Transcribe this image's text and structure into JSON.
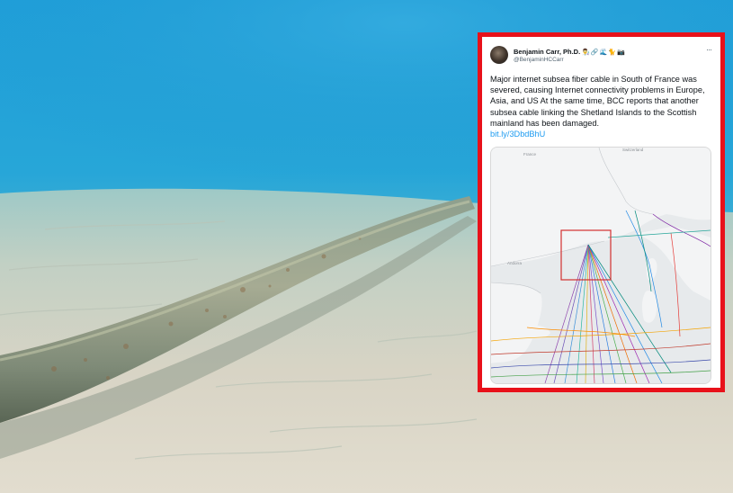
{
  "tweet": {
    "author_name": "Benjamin Carr, Ph.D.",
    "author_emojis": "👨‍🔬🔗🌊🐈📷",
    "handle": "@BenjaminHCCarr",
    "more_menu": "···",
    "body": "Major internet subsea fiber cable in South of France was severed, causing Internet connectivity problems in Europe, Asia, and US At the same time, BCC reports that another subsea cable linking the Shetland Islands to the Scottish mainland has been damaged.",
    "link": "bit.ly/3DbdBhU"
  },
  "map": {
    "labels": [
      "France",
      "Switzerland",
      "Andorra"
    ]
  },
  "colors": {
    "frame_border": "#e8111a",
    "link": "#1d9bf0",
    "water": "#2aa3d8",
    "sand": "#d6d2c4"
  }
}
